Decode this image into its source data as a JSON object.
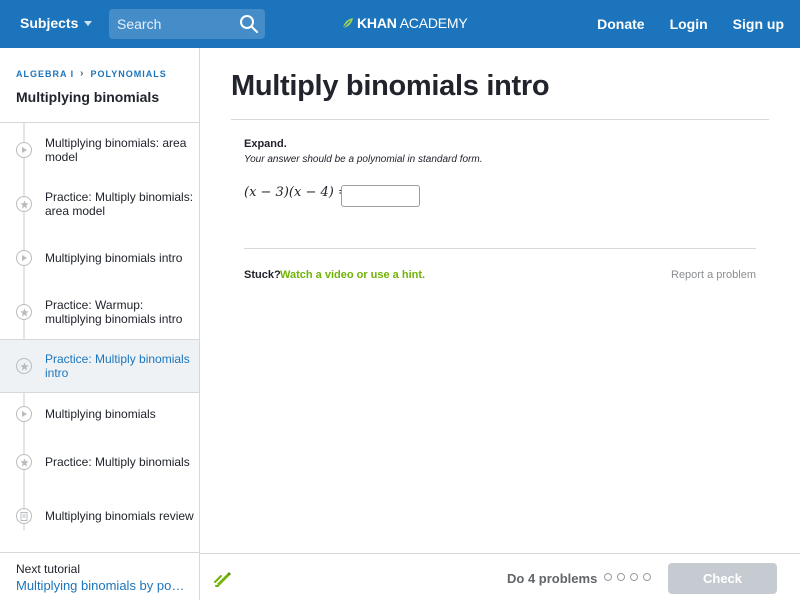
{
  "header": {
    "subjects_label": "Subjects",
    "search_placeholder": "Search",
    "logo_khan": "KHAN",
    "logo_academy": "ACADEMY",
    "links": [
      "Donate",
      "Login",
      "Sign up"
    ]
  },
  "sidebar": {
    "breadcrumb": [
      "ALGEBRA I",
      "POLYNOMIALS"
    ],
    "tutorial_title": "Multiplying binomials",
    "items": [
      {
        "label": "Multiplying binomials: area model",
        "icon": "play-icon"
      },
      {
        "label": "Practice: Multiply binomials: area model",
        "icon": "star-icon"
      },
      {
        "label": "Multiplying binomials intro",
        "icon": "play-icon"
      },
      {
        "label": "Practice: Warmup: multiplying binomials intro",
        "icon": "star-icon"
      },
      {
        "label": "Practice: Multiply binomials intro",
        "icon": "star-icon",
        "active": true
      },
      {
        "label": "Multiplying binomials",
        "icon": "play-icon"
      },
      {
        "label": "Practice: Multiply binomials",
        "icon": "star-icon"
      },
      {
        "label": "Multiplying binomials review",
        "icon": "document-icon"
      }
    ],
    "next_label": "Next tutorial",
    "next_link": "Multiplying binomials by polynomials"
  },
  "main": {
    "title": "Multiply binomials intro",
    "prompt_bold": "Expand.",
    "prompt_instruction": "Your answer should be a polynomial in standard form.",
    "expression": "(x − 3)(x − 4) =",
    "answer_value": "",
    "stuck_label": "Stuck?",
    "hint_link": "Watch a video or use a hint.",
    "report_link": "Report a problem"
  },
  "footer": {
    "do_problems": "Do 4 problems",
    "problem_count": 4,
    "check_label": "Check"
  },
  "colors": {
    "brand_blue": "#1c75bc",
    "hint_green": "#71b307",
    "check_disabled": "#c6cbd1"
  }
}
